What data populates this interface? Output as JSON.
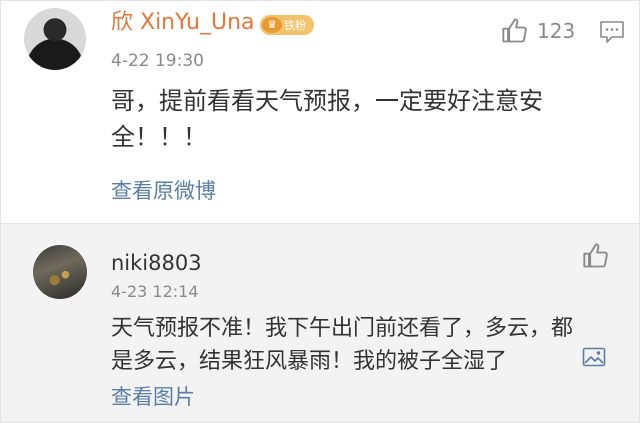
{
  "comments": [
    {
      "username": "欣 XinYu_Una",
      "badge_label": "铁粉",
      "timestamp": "4-22 19:30",
      "like_count": "123",
      "text": "哥，提前看看天气预报，一定要好注意安全！！！",
      "link_label": "查看原微博",
      "name_color": "#e5773a",
      "badge_color": "#f3c26a"
    },
    {
      "username": "niki8803",
      "timestamp": "4-23 12:14",
      "text": "天气预报不准！我下午出门前还看了，多云，都是多云，结果狂风暴雨！我的被子全湿了",
      "link_label": "查看图片"
    }
  ],
  "colors": {
    "link": "#5a7ea8",
    "text": "#333333",
    "meta": "#8a8a8a",
    "reply_bg": "#f3f3f3"
  },
  "icons": [
    "thumbs-up-icon",
    "reply-icon",
    "image-icon",
    "crown-icon"
  ]
}
